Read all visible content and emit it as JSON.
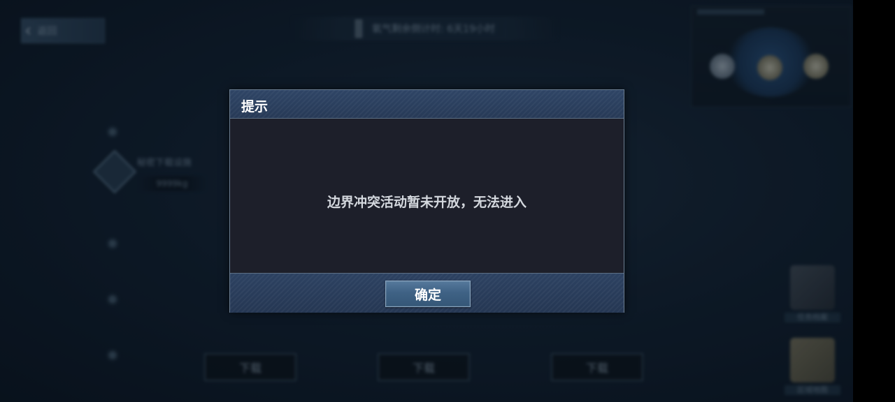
{
  "background": {
    "back_button": {
      "label": "返回"
    },
    "timer_bar": {
      "text": "氧气剩余倒计时: 6天19小时"
    },
    "map_node": {
      "label": "秘密下载设施",
      "sub": "9999kg"
    },
    "slots": [
      {
        "label": "下载"
      },
      {
        "label": "下载"
      },
      {
        "label": "下载"
      }
    ],
    "side_items": [
      {
        "label": "任务档案"
      },
      {
        "label": "区域地图"
      }
    ]
  },
  "dialog": {
    "title": "提示",
    "message": "边界冲突活动暂未开放，无法进入",
    "confirm_label": "确定"
  },
  "colors": {
    "dialog_header": "#2f4566",
    "dialog_body": "#1d1f2a",
    "button": "#3f6285",
    "background": "#132233"
  }
}
